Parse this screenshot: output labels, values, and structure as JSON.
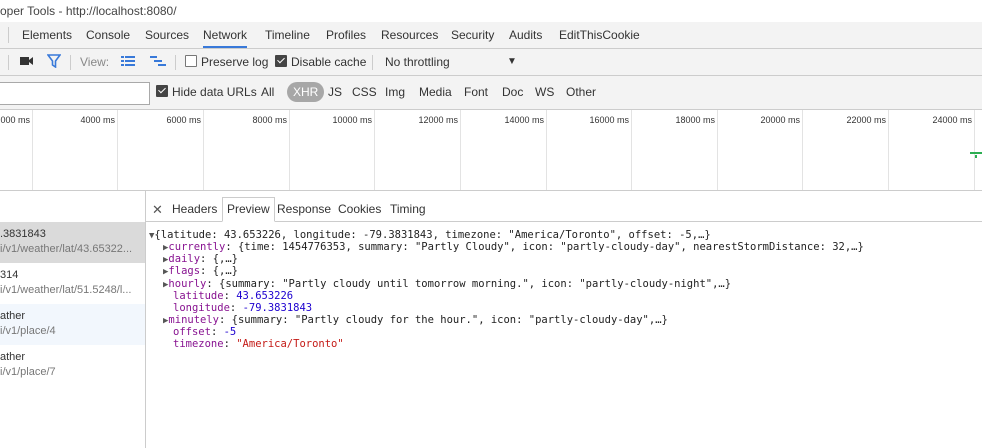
{
  "window": {
    "title": "oper Tools - http://localhost:8080/"
  },
  "panel_tabs": [
    {
      "label": "Elements",
      "active": false
    },
    {
      "label": "Console",
      "active": false
    },
    {
      "label": "Sources",
      "active": false
    },
    {
      "label": "Network",
      "active": true
    },
    {
      "label": "Timeline",
      "active": false
    },
    {
      "label": "Profiles",
      "active": false
    },
    {
      "label": "Resources",
      "active": false
    },
    {
      "label": "Security",
      "active": false
    },
    {
      "label": "Audits",
      "active": false
    },
    {
      "label": "EditThisCookie",
      "active": false
    }
  ],
  "toolbar": {
    "view_label": "View:",
    "preserve_log": {
      "label": "Preserve log",
      "checked": false
    },
    "disable_cache": {
      "label": "Disable cache",
      "checked": true
    },
    "throttling": "No throttling"
  },
  "filter": {
    "value": "",
    "hide_data_urls": {
      "label": "Hide data URLs",
      "checked": true
    },
    "types": [
      "All",
      "XHR",
      "JS",
      "CSS",
      "Img",
      "Media",
      "Font",
      "Doc",
      "WS",
      "Other"
    ],
    "active_type": "XHR"
  },
  "overview": {
    "ticks": [
      "000 ms",
      "4000 ms",
      "6000 ms",
      "8000 ms",
      "10000 ms",
      "12000 ms",
      "14000 ms",
      "16000 ms",
      "18000 ms",
      "20000 ms",
      "22000 ms",
      "24000 ms"
    ]
  },
  "requests": [
    {
      "name": ".3831843",
      "path": "i/v1/weather/lat/43.65322...",
      "selected": true
    },
    {
      "name": "314",
      "path": "i/v1/weather/lat/51.5248/l...",
      "selected": false
    },
    {
      "name": "ather",
      "path": "i/v1/place/4",
      "selected": false
    },
    {
      "name": "ather",
      "path": "i/v1/place/7",
      "selected": false
    }
  ],
  "detail_tabs": [
    {
      "label": "Headers",
      "active": false
    },
    {
      "label": "Preview",
      "active": true
    },
    {
      "label": "Response",
      "active": false
    },
    {
      "label": "Cookies",
      "active": false
    },
    {
      "label": "Timing",
      "active": false
    }
  ],
  "preview": {
    "root": "{latitude: 43.653226, longitude: -79.3831843, timezone: \"America/Toronto\", offset: -5,…}",
    "currently_key": "currently",
    "currently_val": "{time: 1454776353, summary: \"Partly Cloudy\", icon: \"partly-cloudy-day\", nearestStormDistance: 32,…}",
    "daily_key": "daily",
    "daily_val": "{,…}",
    "flags_key": "flags",
    "flags_val": "{,…}",
    "hourly_key": "hourly",
    "hourly_val": "{summary: \"Partly cloudy until tomorrow morning.\", icon: \"partly-cloudy-night\",…}",
    "latitude_key": "latitude",
    "latitude_val": "43.653226",
    "longitude_key": "longitude",
    "longitude_val": "-79.3831843",
    "minutely_key": "minutely",
    "minutely_val": "{summary: \"Partly cloudy for the hour.\", icon: \"partly-cloudy-day\",…}",
    "offset_key": "offset",
    "offset_val": "-5",
    "timezone_key": "timezone",
    "timezone_val": "\"America/Toronto\""
  },
  "colors": {
    "accent": "#3879d9",
    "filter_active": "#3879d9",
    "record": "#333333"
  }
}
